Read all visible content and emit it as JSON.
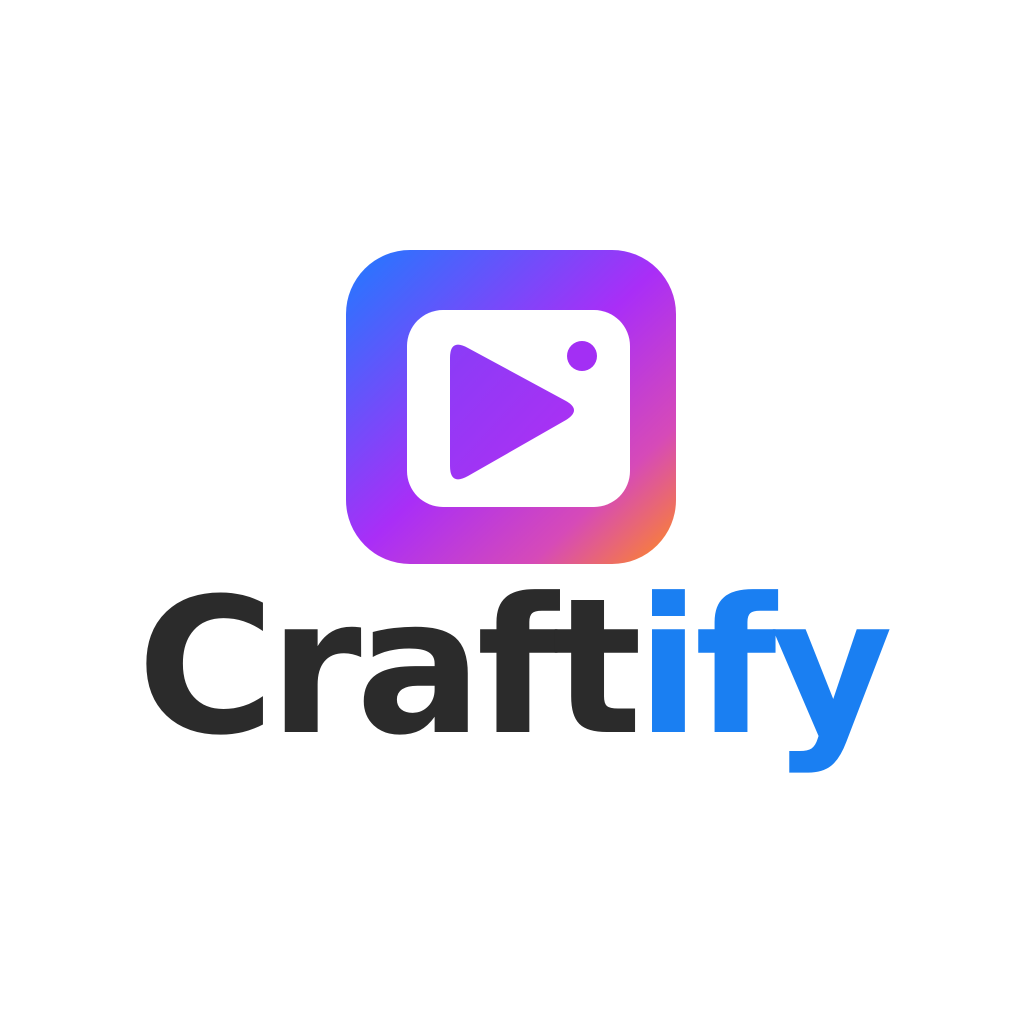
{
  "logo": {
    "icon_name": "video-play-icon",
    "wordmark_dark": "Craft",
    "wordmark_accent": "ify",
    "colors": {
      "background": "#ffffff",
      "gradient_start": "#1e7bff",
      "gradient_mid": "#a92ef7",
      "gradient_end": "#ff8a1f",
      "screen": "#ffffff",
      "wordmark_dark": "#2b2b2b",
      "wordmark_accent": "#1a7ff2"
    }
  }
}
